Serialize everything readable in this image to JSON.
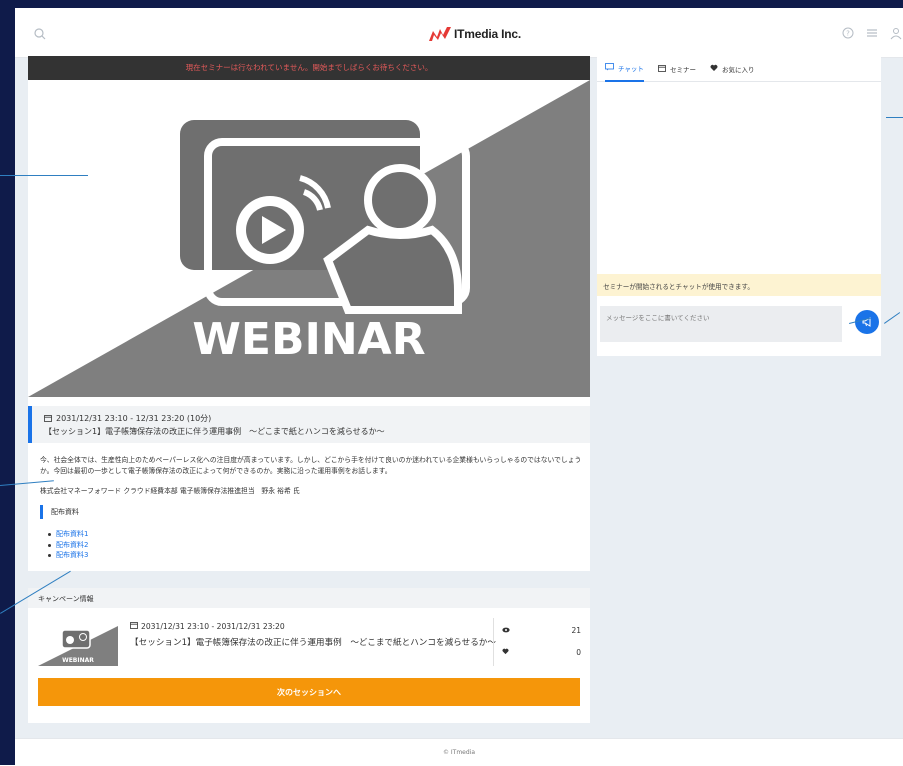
{
  "header": {
    "logo_text": "ITmedia Inc.",
    "icons": [
      "search-icon",
      "help-icon",
      "menu-icon",
      "user-icon"
    ]
  },
  "player": {
    "notice": "現在セミナーは行なわれていません。開始までしばらくお待ちください。",
    "image_text": "WEBINAR"
  },
  "session": {
    "datetime": "2031/12/31 23:10 - 12/31 23:20 (10分)",
    "title": "【セッション1】電子帳簿保存法の改正に伴う運用事例　～どこまで紙とハンコを減らせるか～",
    "description": "今、社会全体では、生産性向上のためペーパーレス化への注目度が高まっています。しかし、どこから手を付けて良いのか迷われている企業様もいらっしゃるのではないでしょうか。今回は最初の一歩として電子帳簿保存法の改正によって何ができるのか。実務に沿った運用事例をお話します。",
    "speaker": "株式会社マネーフォワード クラウド経費本部 電子帳簿保存法推進担当　野永 裕希 氏",
    "materials_heading": "配布資料",
    "materials": [
      "配布資料1",
      "配布資料2",
      "配布資料3"
    ]
  },
  "campaign": {
    "heading": "キャンペーン情報",
    "datetime": "2031/12/31 23:10 - 2031/12/31 23:20",
    "title": "【セッション1】電子帳簿保存法の改正に伴う運用事例　～どこまで紙とハンコを減らせるか～",
    "thumb_text": "WEBINAR",
    "views": "21",
    "likes": "0",
    "next_button": "次のセッションへ"
  },
  "sidebar": {
    "tabs": [
      {
        "label": "チャット",
        "icon": "chat-icon"
      },
      {
        "label": "セミナー",
        "icon": "calendar-icon"
      },
      {
        "label": "お気に入り",
        "icon": "heart-icon"
      }
    ],
    "chat_notice": "セミナーが開始されるとチャットが使用できます。",
    "message_placeholder": "メッセージをここに書いてください"
  },
  "footer": {
    "copyright": "© ITmedia"
  },
  "colors": {
    "accent": "#1a73e8",
    "button": "#f5960a",
    "frame": "#0f1b4a"
  }
}
